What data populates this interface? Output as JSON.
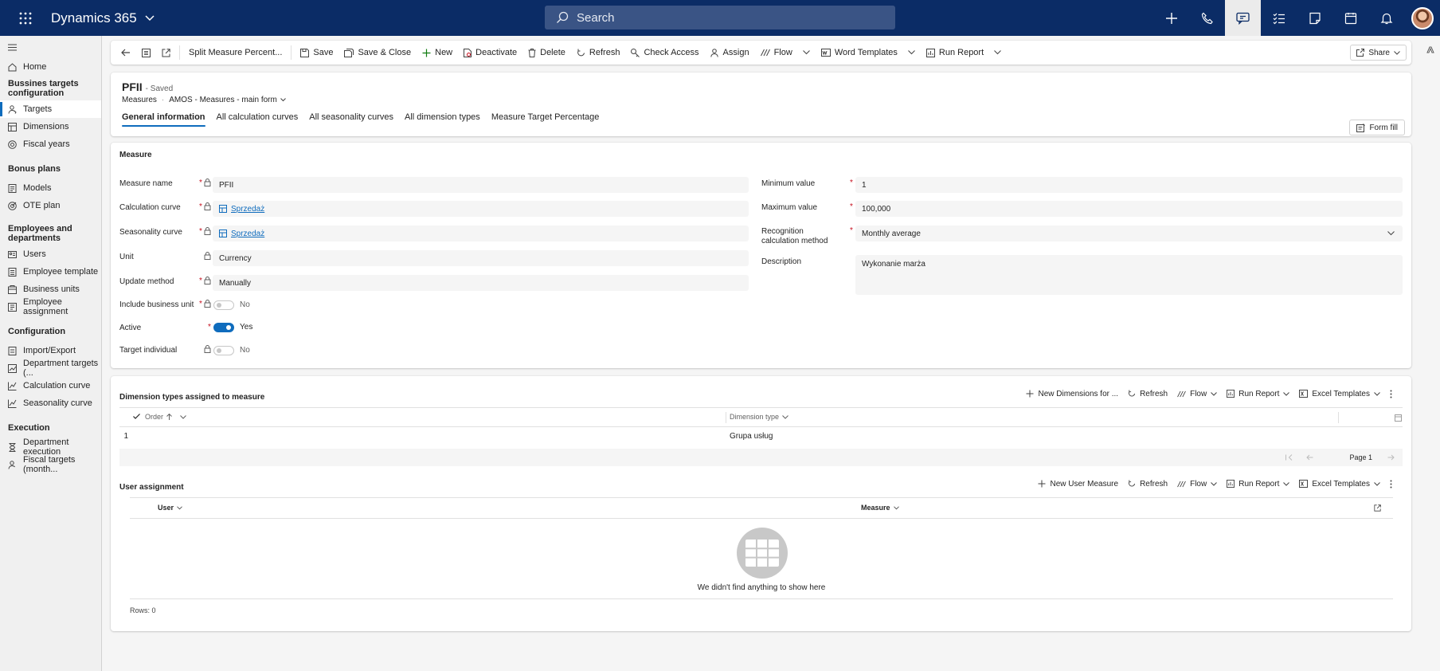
{
  "app": {
    "title": "Dynamics 365"
  },
  "search": {
    "placeholder": "Search"
  },
  "topbar": {
    "icons": [
      "plus-icon",
      "phone-icon",
      "chat-icon",
      "tasks-icon",
      "note-icon",
      "calendar-icon",
      "bell-icon"
    ]
  },
  "sidebar": {
    "home": "Home",
    "group1": "Bussines targets configuration",
    "targets": "Targets",
    "dimensions": "Dimensions",
    "fiscal_years": "Fiscal years",
    "group2": "Bonus plans",
    "models": "Models",
    "ote_plan": "OTE plan",
    "group3": "Employees and departments",
    "users": "Users",
    "employee_template": "Employee template",
    "business_units": "Business units",
    "employee_assignment": "Employee assignment",
    "group4": "Configuration",
    "import_export": "Import/Export",
    "department_targets": "Department targets (...",
    "calculation_curve": "Calculation curve",
    "seasonality_curve": "Seasonality curve",
    "group5": "Execution",
    "department_execution": "Department execution",
    "fiscal_targets": "Fiscal targets (month..."
  },
  "commands": {
    "split": "Split Measure Percent...",
    "save": "Save",
    "save_close": "Save & Close",
    "new": "New",
    "deactivate": "Deactivate",
    "delete": "Delete",
    "refresh": "Refresh",
    "check_access": "Check Access",
    "assign": "Assign",
    "flow": "Flow",
    "word_templates": "Word Templates",
    "run_report": "Run Report",
    "share": "Share"
  },
  "record": {
    "name": "PFII",
    "status": "- Saved",
    "entity": "Measures",
    "form": "AMOS - Measures - main form"
  },
  "tabs": {
    "general": "General information",
    "calc_curves": "All calculation curves",
    "season_curves": "All seasonality curves",
    "dim_types": "All dimension types",
    "target_pct": "Measure Target Percentage"
  },
  "form_fill": "Form fill",
  "measure": {
    "section": "Measure",
    "name_label": "Measure name",
    "name_value": "PFII",
    "calc_label": "Calculation curve",
    "calc_value": "Sprzedaż",
    "season_label": "Seasonality curve",
    "season_value": "Sprzedaż",
    "unit_label": "Unit",
    "unit_value": "Currency",
    "update_label": "Update method",
    "update_value": "Manually",
    "include_label": "Include business unit",
    "include_value": "No",
    "active_label": "Active",
    "active_value": "Yes",
    "target_label": "Target individual",
    "target_value": "No",
    "min_label": "Minimum value",
    "min_value": "1",
    "max_label": "Maximum value",
    "max_value": "100,000",
    "recog_label": "Recognition calculation method",
    "recog_value": "Monthly average",
    "desc_label": "Description",
    "desc_value": "Wykonanie marża"
  },
  "dimension_grid": {
    "title": "Dimension types assigned to measure",
    "new_btn": "New Dimensions for ...",
    "refresh": "Refresh",
    "flow": "Flow",
    "run_report": "Run Report",
    "excel": "Excel Templates",
    "col_order": "Order",
    "col_type": "Dimension type",
    "row_order": "1",
    "row_type": "Grupa usług",
    "page": "Page 1"
  },
  "user_grid": {
    "title": "User assignment",
    "new_btn": "New User Measure",
    "refresh": "Refresh",
    "flow": "Flow",
    "run_report": "Run Report",
    "excel": "Excel Templates",
    "col_user": "User",
    "col_measure": "Measure",
    "empty": "We didn't find anything to show here",
    "rows": "Rows: 0"
  }
}
